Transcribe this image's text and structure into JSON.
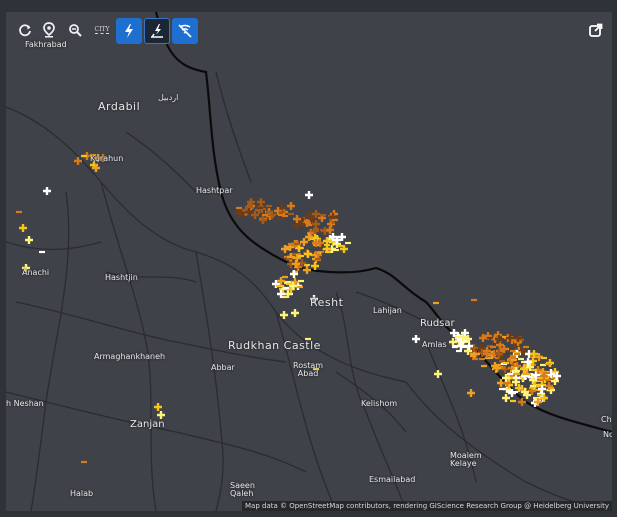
{
  "toolbar": {
    "refresh_icon": "refresh-icon",
    "location_icon": "location-pin-icon",
    "zoom_icon": "zoom-out-icon",
    "city_label": "CITY",
    "toggles": [
      {
        "name": "cloud-to-ground-toggle",
        "icon": "lightning-bolt-icon",
        "state": "on"
      },
      {
        "name": "ground-strike-toggle",
        "icon": "ground-strike-icon",
        "state": "off"
      },
      {
        "name": "no-signal-toggle",
        "icon": "signal-off-icon",
        "state": "on"
      }
    ],
    "export_icon": "share-export-icon"
  },
  "map": {
    "places": {
      "fakhrabad": "Fakhrabad",
      "ardabil": "Ardabil",
      "ardabil_fa": "اردبیل",
      "kurahun": "Kurahun",
      "hashtpar": "Hashtpar",
      "hashtjin": "Hashtjin",
      "anachi": "Anachi",
      "resht": "Resht",
      "lahijan": "Lahijan",
      "rudsar": "Rudsar",
      "amlas": "Amlas",
      "rudkhan_castle": "Rudkhan Castle",
      "armaghankhaneh": "Armaghankhaneh",
      "abbar": "Abbar",
      "rostam_abad": "Rostam\nAbad",
      "kelishom": "Kelishom",
      "neshan": "h Neshan",
      "zanjan": "Zanjan",
      "moalem_kelaye": "Moalem\nKelaye",
      "saeen_qaleh": "Saeen\nQaleh",
      "esmailabad": "Esmailabad",
      "halab": "Halab",
      "cha": "Cha",
      "no": "No"
    },
    "attribution": "Map data © OpenStreetMap contributors, rendering GIScience Research Group @ Heidelberg University",
    "stroke_colors": [
      "#ffffff",
      "#fff27a",
      "#f5c518",
      "#f0a020",
      "#d87a1a",
      "#a65a1a",
      "#6e3c16"
    ]
  }
}
